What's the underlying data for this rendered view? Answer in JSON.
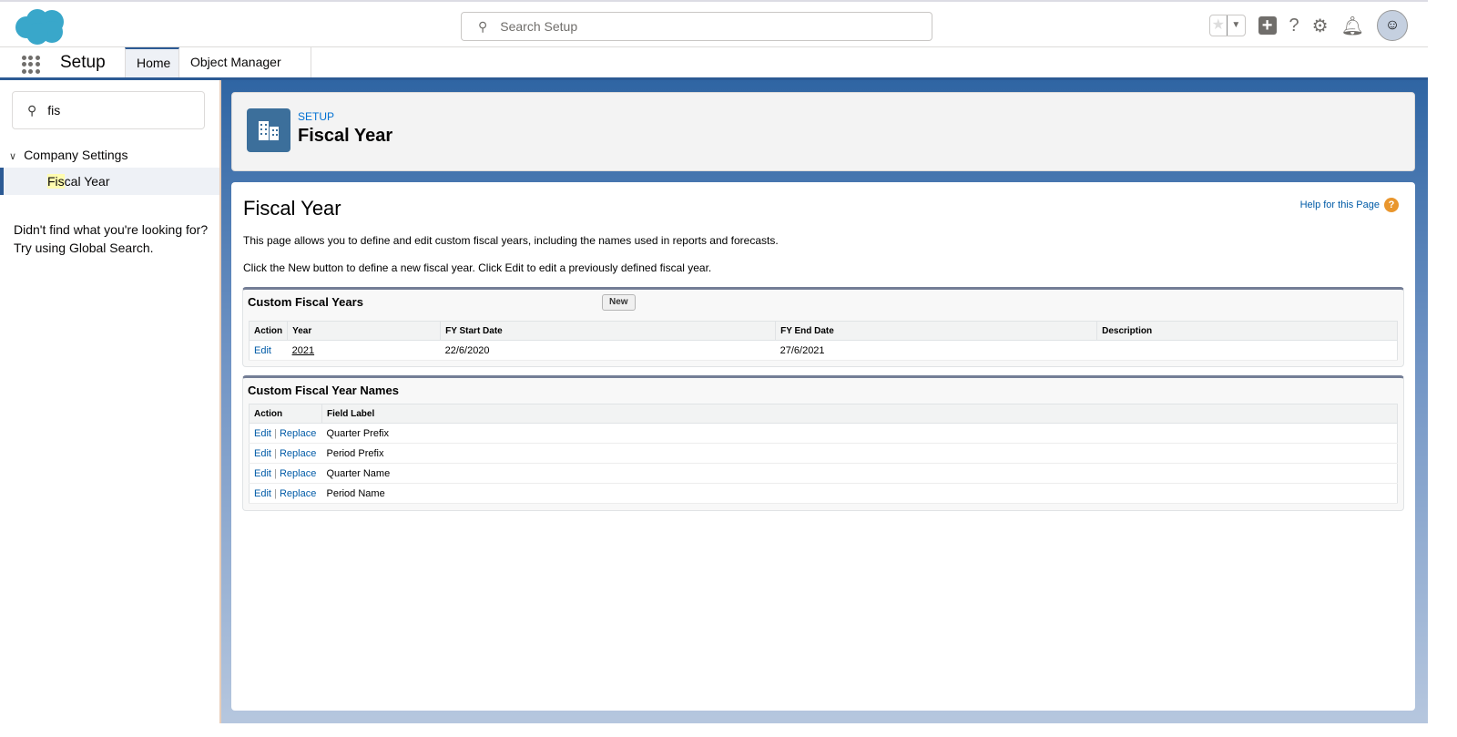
{
  "header": {
    "search_placeholder": "Search Setup"
  },
  "nav": {
    "app_title": "Setup",
    "tabs": [
      {
        "label": "Home"
      },
      {
        "label": "Object Manager"
      }
    ]
  },
  "sidebar": {
    "search_value": "fis",
    "group": "Company Settings",
    "item_match": "Fis",
    "item_rest": "cal Year",
    "not_found_line1": "Didn't find what you're looking for?",
    "not_found_line2": "Try using Global Search."
  },
  "page_header": {
    "breadcrumb": "SETUP",
    "title": "Fiscal Year"
  },
  "content": {
    "title": "Fiscal Year",
    "help_link": "Help for this Page",
    "description1": "This page allows you to define and edit custom fiscal years, including the names used in reports and forecasts.",
    "description2": "Click the New button to define a new fiscal year. Click Edit to edit a previously defined fiscal year.",
    "fiscal_years": {
      "title": "Custom Fiscal Years",
      "new_label": "New",
      "columns": [
        "Action",
        "Year",
        "FY Start Date",
        "FY End Date",
        "Description"
      ],
      "rows": [
        {
          "action": "Edit",
          "year": "2021",
          "start": "22/6/2020",
          "end": "27/6/2021",
          "description": ""
        }
      ]
    },
    "fiscal_names": {
      "title": "Custom Fiscal Year Names",
      "columns": [
        "Action",
        "Field Label"
      ],
      "edit_label": "Edit",
      "replace_label": "Replace",
      "rows": [
        {
          "label": "Quarter Prefix"
        },
        {
          "label": "Period Prefix"
        },
        {
          "label": "Quarter Name"
        },
        {
          "label": "Period Name"
        }
      ]
    }
  }
}
